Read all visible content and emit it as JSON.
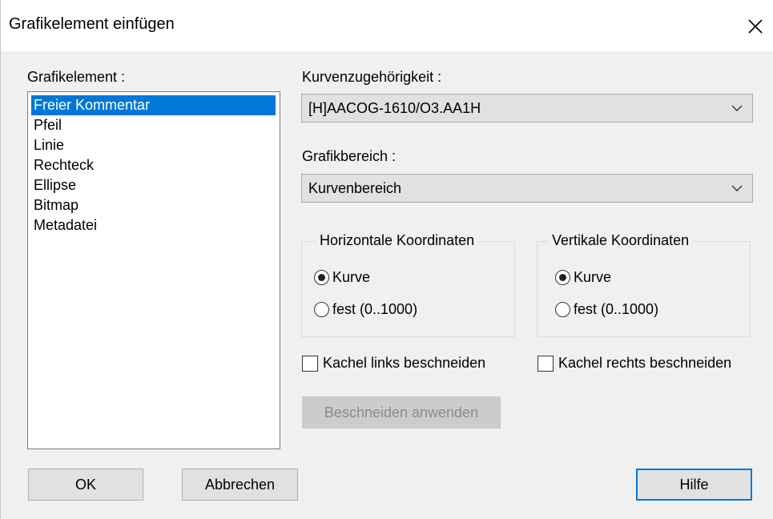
{
  "dialog": {
    "title": "Grafikelement einfügen",
    "close_icon": "close-icon"
  },
  "list": {
    "label": "Grafikelement :",
    "items": [
      "Freier Kommentar",
      "Pfeil",
      "Linie",
      "Rechteck",
      "Ellipse",
      "Bitmap",
      "Metadatei"
    ],
    "selected": "Freier Kommentar"
  },
  "curve": {
    "label": "Kurvenzugehörigkeit :",
    "value": "[H]AACOG-1610/O3.AA1H"
  },
  "area": {
    "label": "Grafikbereich :",
    "value": "Kurvenbereich"
  },
  "horizontal": {
    "legend": "Horizontale Koordinaten",
    "option1": "Kurve",
    "option2": "fest (0..1000)",
    "selected": "Kurve"
  },
  "vertical": {
    "legend": "Vertikale Koordinaten",
    "option1": "Kurve",
    "option2": "fest (0..1000)",
    "selected": "Kurve"
  },
  "crop": {
    "left_label": "Kachel links beschneiden",
    "right_label": "Kachel rechts beschneiden",
    "left_checked": false,
    "right_checked": false,
    "apply_label": "Beschneiden anwenden"
  },
  "buttons": {
    "ok": "OK",
    "cancel": "Abbrechen",
    "help": "Hilfe"
  },
  "colors": {
    "selection": "#0078d7",
    "dialog_bg": "#f0f0f0",
    "button_bg": "#e1e1e1"
  }
}
